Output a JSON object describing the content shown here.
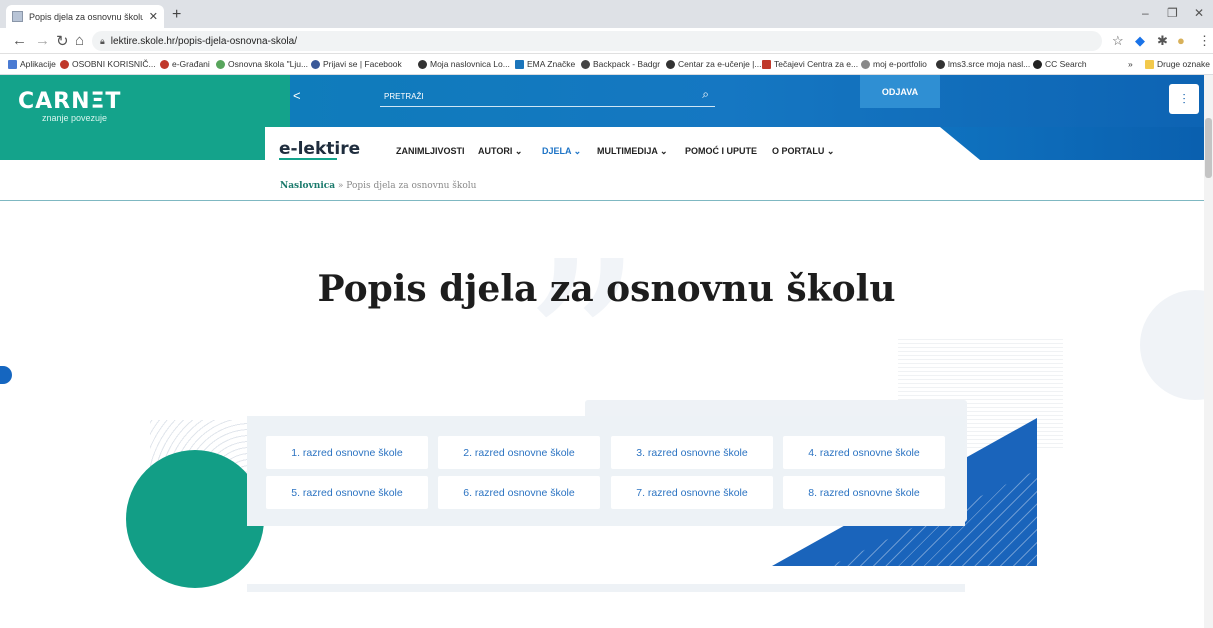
{
  "browser": {
    "tab_title": "Popis djela za osnovnu školu – e",
    "tab_close": "✕",
    "new_tab": "+",
    "url": "lektire.skole.hr/popis-djela-osnovna-skola/",
    "window_controls": [
      "–",
      "❐",
      "✕"
    ],
    "bookmarks": [
      {
        "label": "Aplikacije",
        "icon": "apps-icon",
        "color": "#4a7bd3"
      },
      {
        "label": "OSOBNI KORISNIČ...",
        "icon": "grid-icon",
        "color": "#c0392b"
      },
      {
        "label": "e-Građani",
        "icon": "grid-icon",
        "color": "#c0392b"
      },
      {
        "label": "Osnovna škola \"Lju...",
        "icon": "school-icon",
        "color": "#58a55c"
      },
      {
        "label": "Prijavi se | Facebook",
        "icon": "facebook-icon",
        "color": "#3b5998"
      },
      {
        "label": "Moja naslovnica Lo...",
        "icon": "globe-icon",
        "color": "#333333"
      },
      {
        "label": "EMA Značke",
        "icon": "badge-icon",
        "color": "#1b75bb"
      },
      {
        "label": "Backpack - Badgr",
        "icon": "backpack-icon",
        "color": "#444444"
      },
      {
        "label": "Centar za e-učenje |...",
        "icon": "globe-icon",
        "color": "#333333"
      },
      {
        "label": "Tečajevi Centra za e...",
        "icon": "course-icon",
        "color": "#c0392b"
      },
      {
        "label": "moj e-portfolio",
        "icon": "pin-icon",
        "color": "#888888"
      },
      {
        "label": "lms3.srce moja nasl...",
        "icon": "globe-icon",
        "color": "#333333"
      },
      {
        "label": "CC Search",
        "icon": "cc-icon",
        "color": "#222222"
      }
    ],
    "other_bookmarks": "Druge oznake",
    "more_bookmarks": "»"
  },
  "site": {
    "logo": "CARNΞT",
    "logo_subtitle": "znanje povezuje",
    "search_placeholder": "PRETRAŽI",
    "logout_label": "ODJAVA",
    "brand": "e-lektire",
    "menu": [
      {
        "label": "ZANIMLJIVOSTI",
        "active": false
      },
      {
        "label": "AUTORI ⌄",
        "active": false
      },
      {
        "label": "DJELA ⌄",
        "active": true
      },
      {
        "label": "MULTIMEDIJA ⌄",
        "active": false
      },
      {
        "label": "POMOĆ I UPUTE",
        "active": false
      },
      {
        "label": "O PORTALU ⌄",
        "active": false
      }
    ],
    "breadcrumb_home": "Naslovnica",
    "breadcrumb_sep": " » ",
    "breadcrumb_current": "Popis djela za osnovnu školu",
    "accent_green": "#14a38b",
    "accent_blue": "#1566c0"
  },
  "main": {
    "title": "Popis djela za osnovnu školu",
    "grades": [
      "1. razred osnovne škole",
      "2. razred osnovne škole",
      "3. razred osnovne škole",
      "4. razred osnovne škole",
      "5. razred osnovne škole",
      "6. razred osnovne škole",
      "7. razred osnovne škole",
      "8. razred osnovne škole"
    ]
  }
}
